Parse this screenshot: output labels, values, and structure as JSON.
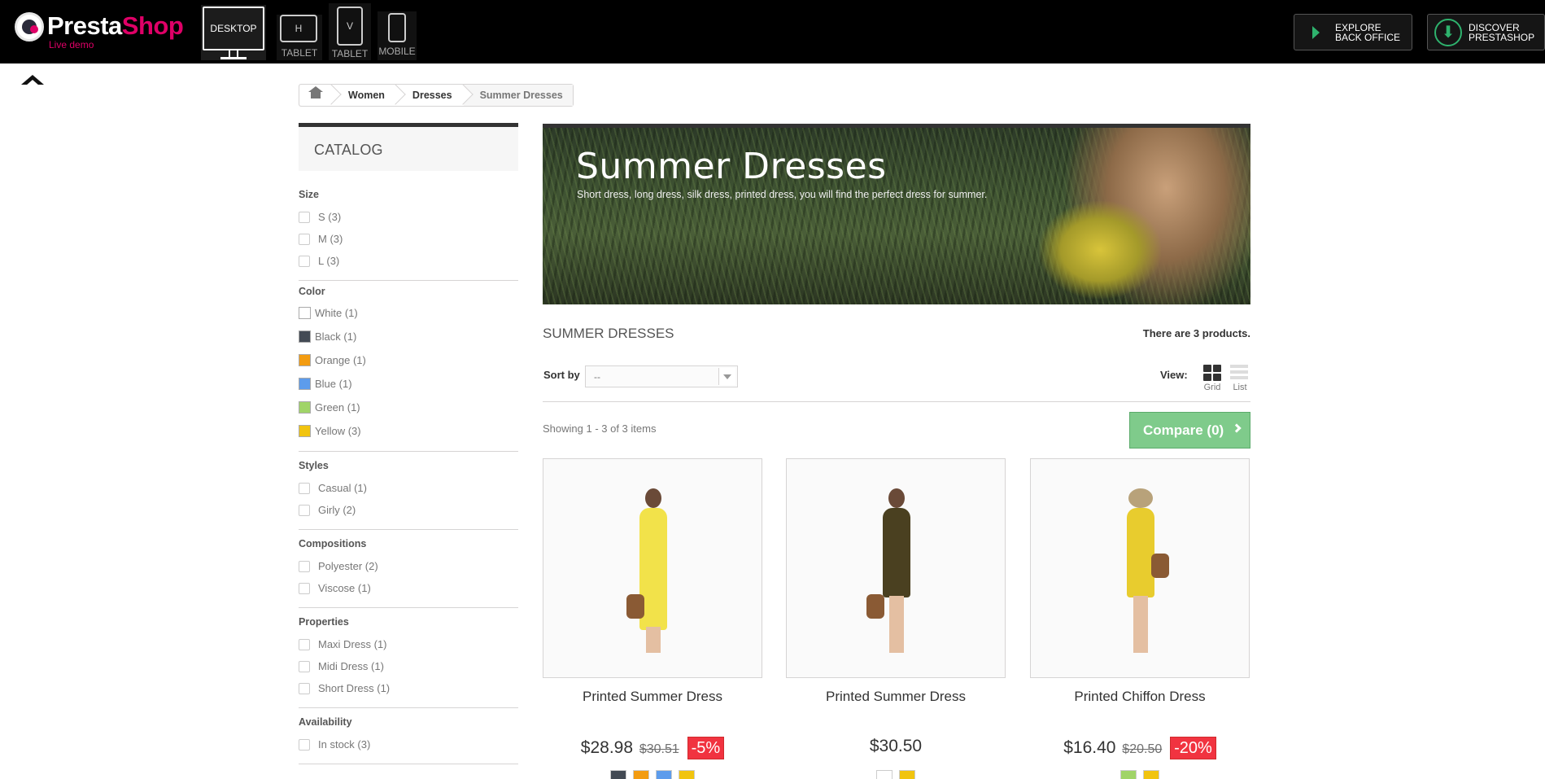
{
  "topbar": {
    "logo_presta": "Presta",
    "logo_shop": "Shop",
    "logo_sub": "Live demo",
    "devices": {
      "desktop": "DESKTOP",
      "htablet_letter": "H",
      "htablet_label": "TABLET",
      "vtablet_letter": "V",
      "vtablet_label": "TABLET",
      "mobile_label": "MOBILE"
    },
    "explore": {
      "line1": "EXPLORE",
      "line2": "BACK OFFICE"
    },
    "discover": {
      "line1": "DISCOVER",
      "line2": "PRESTASHOP"
    }
  },
  "breadcrumb": [
    "Women",
    "Dresses",
    "Summer Dresses"
  ],
  "sidebar": {
    "title": "CATALOG",
    "filters": {
      "size": {
        "title": "Size",
        "items": [
          "S (3)",
          "M (3)",
          "L (3)"
        ]
      },
      "color": {
        "title": "Color",
        "items": [
          {
            "label": "White (1)",
            "color": "#ffffff"
          },
          {
            "label": "Black (1)",
            "color": "#434a54"
          },
          {
            "label": "Orange (1)",
            "color": "#f39c11"
          },
          {
            "label": "Blue (1)",
            "color": "#5d9cec"
          },
          {
            "label": "Green (1)",
            "color": "#a0d468"
          },
          {
            "label": "Yellow (3)",
            "color": "#f1c40f"
          }
        ]
      },
      "styles": {
        "title": "Styles",
        "items": [
          "Casual (1)",
          "Girly (2)"
        ]
      },
      "compositions": {
        "title": "Compositions",
        "items": [
          "Polyester (2)",
          "Viscose (1)"
        ]
      },
      "properties": {
        "title": "Properties",
        "items": [
          "Maxi Dress (1)",
          "Midi Dress (1)",
          "Short Dress (1)"
        ]
      },
      "availability": {
        "title": "Availability",
        "items": [
          "In stock (3)"
        ]
      }
    }
  },
  "banner": {
    "title": "Summer Dresses",
    "subtitle": "Short dress, long dress, silk dress, printed dress, you will find the perfect dress for summer."
  },
  "category": {
    "name": "SUMMER DRESSES",
    "count": "There are 3 products.",
    "sort_label": "Sort by",
    "sort_value": "--",
    "view_label": "View:",
    "view_grid": "Grid",
    "view_list": "List",
    "showing": "Showing 1 - 3 of 3 items",
    "compare": "Compare (0)"
  },
  "products": [
    {
      "name": "Printed Summer Dress",
      "price": "$28.98",
      "old_price": "$30.51",
      "discount": "-5%",
      "colors": [
        "#434a54",
        "#f39c11",
        "#5d9cec",
        "#f1c40f"
      ],
      "dress": "#f2e24a",
      "bag": "left"
    },
    {
      "name": "Printed Summer Dress",
      "price": "$30.50",
      "old_price": "",
      "discount": "",
      "colors": [
        "#ffffff",
        "#f1c40f"
      ],
      "dress": "#4a4020",
      "bag": "left"
    },
    {
      "name": "Printed Chiffon Dress",
      "price": "$16.40",
      "old_price": "$20.50",
      "discount": "-20%",
      "colors": [
        "#a0d468",
        "#f1c40f"
      ],
      "dress": "#e8cc2e",
      "bag": "right"
    }
  ]
}
